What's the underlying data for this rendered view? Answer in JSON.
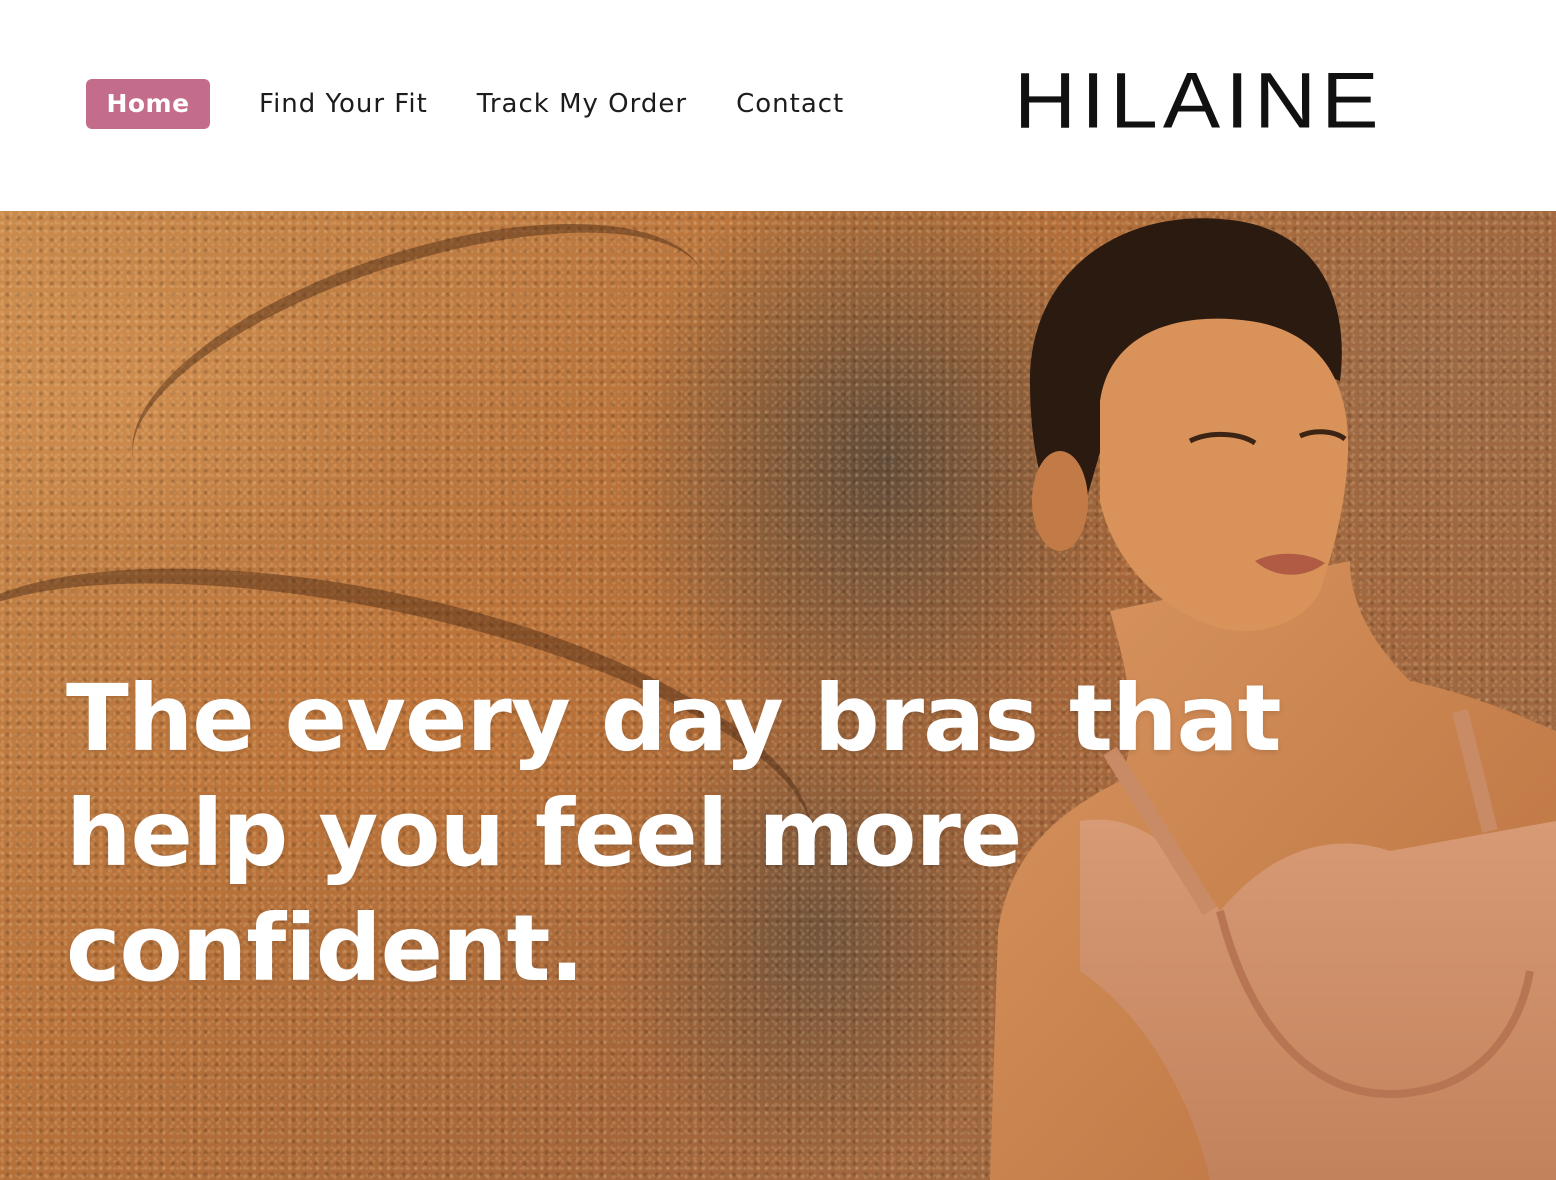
{
  "header": {
    "nav": [
      {
        "label": "Home",
        "active": true
      },
      {
        "label": "Find Your Fit",
        "active": false
      },
      {
        "label": "Track My Order",
        "active": false
      },
      {
        "label": "Contact",
        "active": false
      }
    ],
    "logo_text": "HILAINE"
  },
  "hero": {
    "headline_lines": [
      "The every day bras that",
      "help you feel more",
      "confident."
    ],
    "image_description_icon": "model-photo"
  },
  "colors": {
    "accent": "#c46c8b",
    "logo": "#111111",
    "headline": "#ffffff"
  }
}
